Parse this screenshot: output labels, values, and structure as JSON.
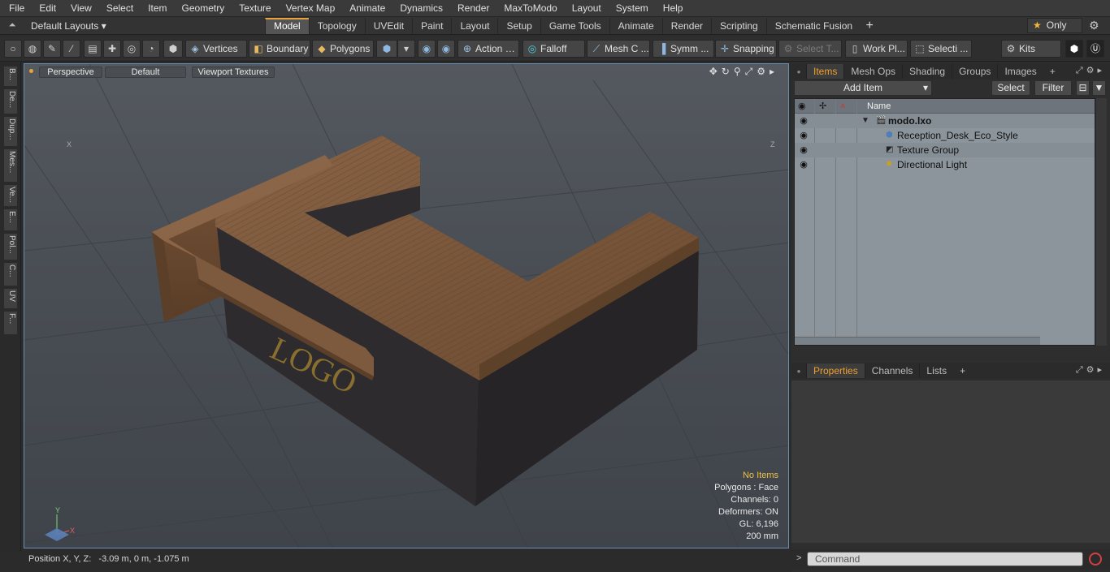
{
  "menu": [
    "File",
    "Edit",
    "View",
    "Select",
    "Item",
    "Geometry",
    "Texture",
    "Vertex Map",
    "Animate",
    "Dynamics",
    "Render",
    "MaxToModo",
    "Layout",
    "System",
    "Help"
  ],
  "layouts_label": "Default Layouts ▾",
  "tabs": [
    {
      "label": "Model",
      "active": true
    },
    {
      "label": "Topology"
    },
    {
      "label": "UVEdit"
    },
    {
      "label": "Paint"
    },
    {
      "label": "Layout"
    },
    {
      "label": "Setup"
    },
    {
      "label": "Game Tools"
    },
    {
      "label": "Animate"
    },
    {
      "label": "Render"
    },
    {
      "label": "Scripting"
    },
    {
      "label": "Schematic Fusion"
    }
  ],
  "only_label": "Only",
  "toolbar": {
    "vertices": "Vertices",
    "boundary": "Boundary",
    "polygons": "Polygons",
    "action": "Action",
    "falloff": "Falloff",
    "mesh": "Mesh C ...",
    "symm": "Symm ...",
    "snapping": "Snapping",
    "select_t": "Select T...",
    "work_plane": "Work Pl...",
    "selecti": "Selecti ...",
    "kits": "Kits"
  },
  "left_tabs": [
    "B...",
    "De...",
    "Dup...",
    "Mes...",
    "Ve...",
    "E...",
    "Pol...",
    "C...",
    "UV",
    "F..."
  ],
  "viewport": {
    "view": "Perspective",
    "shading": "Default",
    "textures": "Viewport Textures",
    "info": {
      "selection": "No Items",
      "polygons": "Polygons : Face",
      "channels": "Channels: 0",
      "deformers": "Deformers: ON",
      "gl": "GL: 6,196",
      "scale": "200 mm"
    },
    "decal_text": "LOGO",
    "axis_x": "X",
    "axis_y": "Y",
    "corner_x": "X",
    "corner_z": "Z"
  },
  "status": {
    "label": "Position X, Y, Z:",
    "value": "-3.09 m, 0 m, -1.075 m"
  },
  "items_panel": {
    "tabs": [
      "Items",
      "Mesh Ops",
      "Shading",
      "Groups",
      "Images"
    ],
    "add_item": "Add Item",
    "select": "Select",
    "filter": "Filter",
    "col_name": "Name",
    "rows": [
      {
        "label": "modo.lxo",
        "bold": true
      },
      {
        "label": "Reception_Desk_Eco_Style"
      },
      {
        "label": "Texture Group"
      },
      {
        "label": "Directional Light"
      }
    ]
  },
  "props_panel": {
    "tabs": [
      "Properties",
      "Channels",
      "Lists"
    ]
  },
  "command": {
    "placeholder": "Command"
  }
}
